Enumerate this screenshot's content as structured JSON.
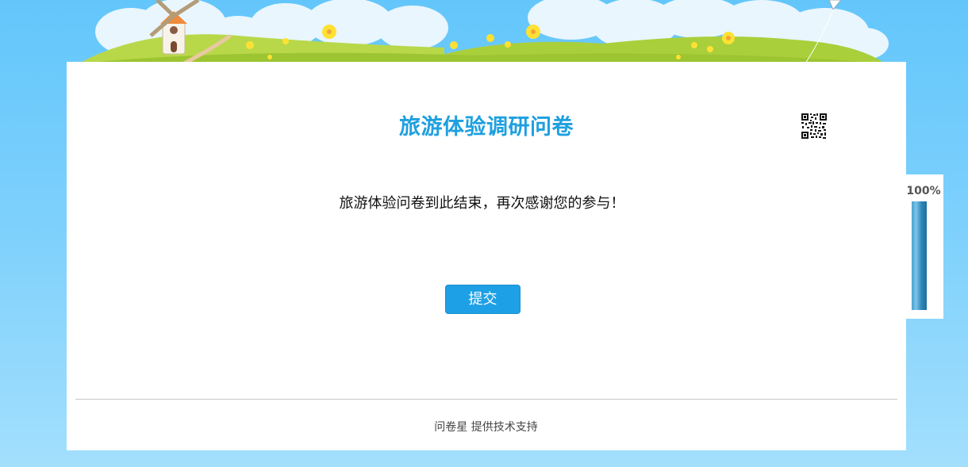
{
  "survey": {
    "title": "旅游体验调研问卷",
    "end_message": "旅游体验问卷到此结束，再次感谢您的参与！",
    "submit_label": "提交"
  },
  "footer": {
    "credit": "问卷星 提供技术支持"
  },
  "progress": {
    "label": "100%",
    "fraction": 1.0
  },
  "colors": {
    "title": "#1ea0e0",
    "button": "#1ea0e6",
    "background_sky": "#7fd1fc"
  },
  "icons": {
    "qr": "qr-code-icon"
  }
}
